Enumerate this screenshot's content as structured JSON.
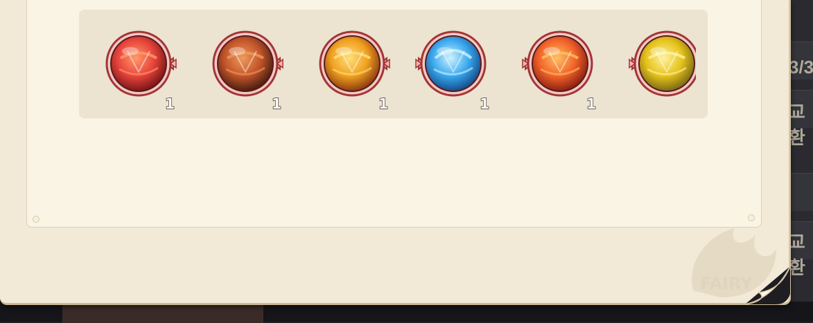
{
  "rewards": [
    {
      "name": "red-light-pillar-orb",
      "count": "1",
      "primary": "#e8453c",
      "secondary": "#ff9a6a",
      "dark": "#7a1616"
    },
    {
      "name": "brown-swirl-orb",
      "count": "1",
      "primary": "#c2552a",
      "secondary": "#f09a5a",
      "dark": "#4a1e12"
    },
    {
      "name": "golden-whirlwind-orb",
      "count": "1",
      "primary": "#f0a020",
      "secondary": "#ffe07a",
      "dark": "#8a3d10"
    },
    {
      "name": "blue-ice-crystal-orb",
      "count": "1",
      "primary": "#3aa8ee",
      "secondary": "#cdf2ff",
      "dark": "#134e8c"
    },
    {
      "name": "fire-flame-orb",
      "count": "1",
      "primary": "#f2632a",
      "secondary": "#ffc060",
      "dark": "#8a2010"
    },
    {
      "name": "yellow-lightning-orb",
      "count": "",
      "primary": "#e6c21a",
      "secondary": "#fff3a0",
      "dark": "#7a6a18"
    }
  ],
  "background": {
    "right_edge_text_1": "3/3",
    "right_edge_text_2": "교환",
    "right_edge_text_3": "교환",
    "watermark": "FAIRY"
  }
}
